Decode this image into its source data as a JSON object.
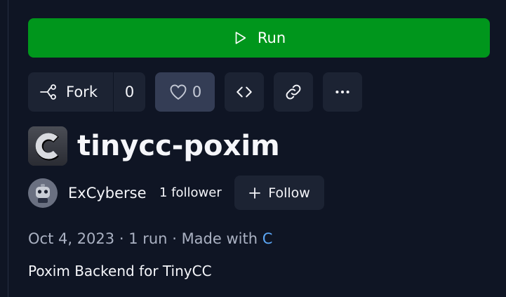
{
  "actions": {
    "run_label": "Run",
    "fork_label": "Fork",
    "fork_count": "0",
    "like_count": "0"
  },
  "repl": {
    "title": "tinycc-poxim",
    "language_icon_letter": "C",
    "author": {
      "name": "ExCyberse",
      "followers": "1 follower",
      "follow_label": "Follow"
    },
    "meta": {
      "date": "Oct 4, 2023",
      "sep1": "·",
      "runs": "1 run",
      "sep2": "·",
      "made_with": "Made with",
      "language": "C"
    },
    "description": "Poxim Backend for TinyCC"
  },
  "icons": {
    "run": "play-icon",
    "fork": "fork-icon",
    "like": "heart-icon",
    "embed": "code-icon",
    "link": "link-icon",
    "more": "ellipsis-icon",
    "follow": "plus-icon"
  },
  "colors": {
    "background": "#0f1524",
    "run_button": "#00961c",
    "button_bg": "#1c2333",
    "like_bg": "#343d55",
    "muted_text": "#aab1c2",
    "link_text": "#5ba6f5"
  }
}
